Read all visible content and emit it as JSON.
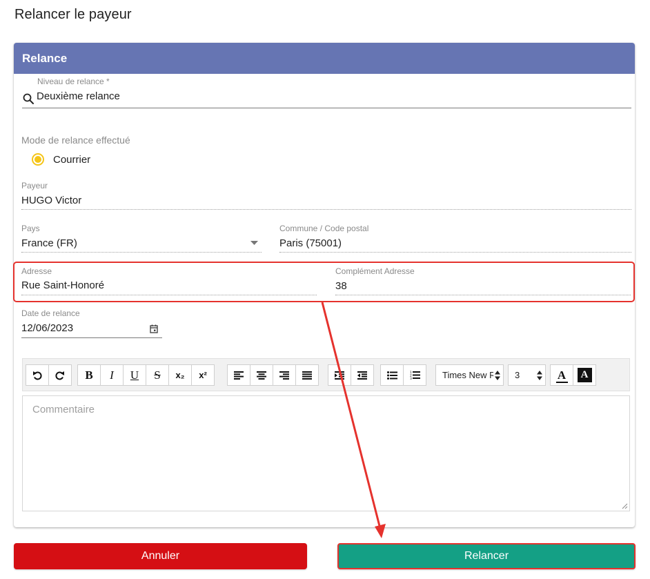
{
  "page": {
    "title": "Relancer le payeur"
  },
  "card": {
    "header": "Relance"
  },
  "niveau": {
    "label": "Niveau de relance *",
    "value": "Deuxième relance"
  },
  "mode": {
    "label": "Mode de relance effectué",
    "option": "Courrier",
    "selected": true
  },
  "payeur": {
    "label": "Payeur",
    "value": "HUGO Victor"
  },
  "pays": {
    "label": "Pays",
    "value": "France (FR)"
  },
  "commune": {
    "label": "Commune / Code postal",
    "value": "Paris (75001)"
  },
  "adresse": {
    "label": "Adresse",
    "value": "Rue Saint-Honoré"
  },
  "complement": {
    "label": "Complément Adresse",
    "value": "38"
  },
  "date": {
    "label": "Date de relance",
    "value": "12/06/2023"
  },
  "toolbar": {
    "font_family": "Times New Roman",
    "font_size": "3",
    "bold": "B",
    "italic": "I",
    "underline": "U",
    "strike": "S",
    "subscript": "x₂",
    "superscript": "x²",
    "font_color": "A",
    "bg_color": "A"
  },
  "comment": {
    "placeholder": "Commentaire"
  },
  "actions": {
    "cancel": "Annuler",
    "submit": "Relancer"
  },
  "colors": {
    "header": "#6675b3",
    "radio": "#f5c518",
    "cancel": "#d50f14",
    "submit": "#14a085",
    "annotation": "#e5322d"
  }
}
